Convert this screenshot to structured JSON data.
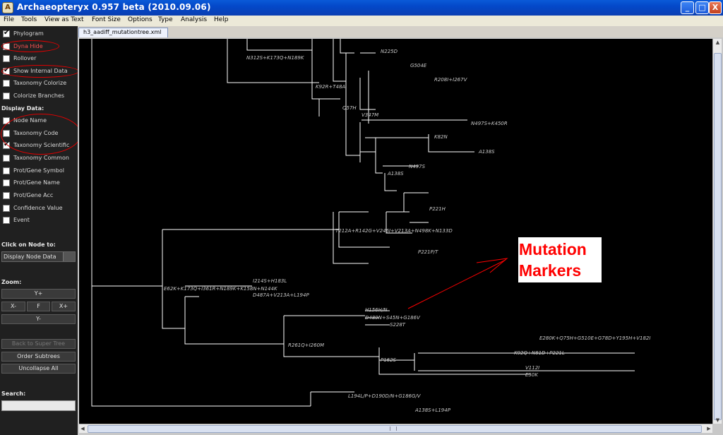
{
  "window": {
    "title": "Archaeopteryx 0.957 beta (2010.09.06)",
    "minimize_glyph": "_",
    "maximize_glyph": "□",
    "close_glyph": "X"
  },
  "menus": [
    "File",
    "Tools",
    "View as Text",
    "Font Size",
    "Options",
    "Type",
    "Analysis",
    "Help"
  ],
  "panel": {
    "options": [
      {
        "label": "Phylogram",
        "checked": true
      },
      {
        "label": "Dyna Hide",
        "checked": false
      },
      {
        "label": "Rollover",
        "checked": false
      },
      {
        "label": "Show Internal Data",
        "checked": true
      },
      {
        "label": "Taxonomy Colorize",
        "checked": false
      },
      {
        "label": "Colorize Branches",
        "checked": false
      }
    ],
    "display_heading": "Display Data:",
    "display_options": [
      {
        "label": "Node Name",
        "checked": false
      },
      {
        "label": "Taxonomy Code",
        "checked": false
      },
      {
        "label": "Taxonomy Scientific",
        "checked": true
      },
      {
        "label": "Taxonomy Common",
        "checked": false
      },
      {
        "label": "Prot/Gene Symbol",
        "checked": false
      },
      {
        "label": "Prot/Gene Name",
        "checked": false
      },
      {
        "label": "Prot/Gene Acc",
        "checked": false
      },
      {
        "label": "Confidence Value",
        "checked": false
      },
      {
        "label": "Event",
        "checked": false
      }
    ],
    "click_heading": "Click on Node to:",
    "click_value": "Display Node Data",
    "zoom_heading": "Zoom:",
    "zoom_buttons": {
      "y_plus": "Y+",
      "x_minus": "X-",
      "fit": "F",
      "x_plus": "X+",
      "y_minus": "Y-"
    },
    "back_button": "Back to Super Tree",
    "order_button": "Order Subtrees",
    "uncollapse_button": "Uncollapse All",
    "search_heading": "Search:",
    "search_value": ""
  },
  "tab": {
    "label": "h3_aadiff_mutationtree.xml"
  },
  "tree": {
    "labels": [
      "N312S+K173Q+N189K",
      "N225D",
      "G504E",
      "R208I+I267V",
      "K92R+T48A",
      "Q57H",
      "V347M",
      "N497S+K450R",
      "K82N",
      "A138S",
      "N497S",
      "A138S",
      "P221H",
      "T212A+R142G+V246I+V213A+N498K+N133D",
      "P221P/T",
      "I214S+H183L",
      "E62K+K173Q+I361R+N189K+K158N+N144K",
      "D487A+V213A+L194P",
      "H156H/N",
      "D489N+S45N+G186V",
      "S228T",
      "R261Q+I260M",
      "E280K+Q75H+G510E+G78D+Y195H+V182I",
      "K92Q+N81D+P221L",
      "P162S",
      "V112I",
      "E50K",
      "L194L/P+D190D/N+G186G/V",
      "A138S+L194P"
    ]
  },
  "annotation": {
    "line1": "Mutation",
    "line2": "Markers"
  },
  "colors": {
    "annotation": "#ff0000",
    "tree_line": "#ffffff",
    "tree_label": "#c8c8c8"
  }
}
